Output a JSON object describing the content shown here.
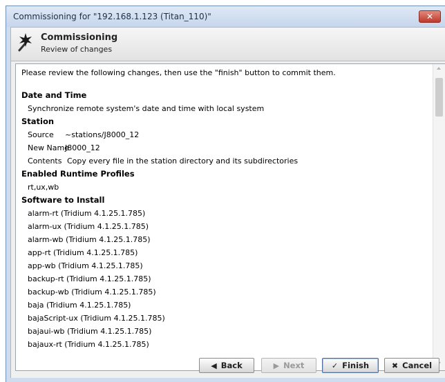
{
  "window": {
    "title": "Commissioning for \"192.168.1.123 (Titan_110)\"",
    "close_glyph": "✕"
  },
  "header": {
    "title": "Commissioning",
    "subtitle": "Review of changes",
    "icon": "magic-wand-icon"
  },
  "content": {
    "intro": "Please review the following changes, then use the \"finish\" button to commit them.",
    "date_time": {
      "title": "Date and Time",
      "text": "Synchronize remote system's date and time with local system"
    },
    "station": {
      "title": "Station",
      "source_label": "Source",
      "source_value": "~stations/J8000_12",
      "new_name_label": "New Name",
      "new_name_value": "J8000_12",
      "contents_label": "Contents",
      "contents_value": "Copy every file in the station directory and its subdirectories"
    },
    "profiles": {
      "title": "Enabled Runtime Profiles",
      "value": "rt,ux,wb"
    },
    "software": {
      "title": "Software to Install",
      "items": [
        "alarm-rt (Tridium 4.1.25.1.785)",
        "alarm-ux (Tridium 4.1.25.1.785)",
        "alarm-wb (Tridium 4.1.25.1.785)",
        "app-rt (Tridium 4.1.25.1.785)",
        "app-wb (Tridium 4.1.25.1.785)",
        "backup-rt (Tridium 4.1.25.1.785)",
        "backup-wb (Tridium 4.1.25.1.785)",
        "baja (Tridium 4.1.25.1.785)",
        "bajaScript-ux (Tridium 4.1.25.1.785)",
        "bajaui-wb (Tridium 4.1.25.1.785)",
        "bajaux-rt (Tridium 4.1.25.1.785)"
      ]
    }
  },
  "buttons": {
    "back": "Back",
    "back_icon": "◀",
    "next": "Next",
    "next_icon": "▶",
    "finish": "Finish",
    "finish_icon": "✓",
    "cancel": "Cancel",
    "cancel_icon": "✖"
  },
  "colors": {
    "frame": "#cfdcee",
    "close": "#c0392b",
    "content_bg": "#ffffff"
  }
}
